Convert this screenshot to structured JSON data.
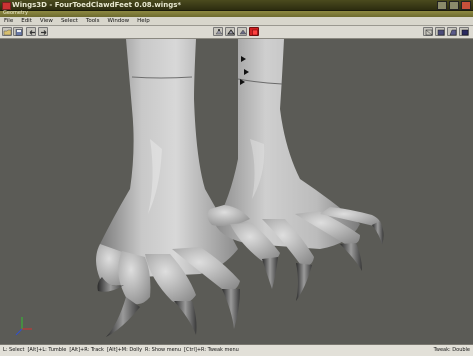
{
  "window": {
    "title": "Wings3D - FourToedClawdFeet 0.08.wings*"
  },
  "geometry_label": "Geometry",
  "menu": [
    "File",
    "Edit",
    "View",
    "Select",
    "Tools",
    "Window",
    "Help"
  ],
  "toolbar": {
    "left_icons": [
      "folder-open-icon",
      "save-icon",
      "undo-icon",
      "redo-icon"
    ],
    "selection_modes": [
      "vertex-mode-icon",
      "edge-mode-icon",
      "face-mode-icon",
      "body-mode-icon"
    ],
    "selected_mode": "body-mode-icon",
    "view_modes": [
      "wireframe-icon",
      "smooth-shaded-icon",
      "perspective-icon",
      "flat-shaded-icon"
    ]
  },
  "status": {
    "hints": [
      "L: Select",
      "[Alt]+L: Tumble",
      "[Alt]+R: Track",
      "[Alt]+M: Dolly",
      "R: Show menu",
      "[Ctrl]+R: Tweak menu"
    ],
    "right": "Tweak: Double"
  },
  "colors": {
    "accent": "#d02020",
    "viewport": "#5b5b56",
    "mesh": "#bdbdbd"
  }
}
